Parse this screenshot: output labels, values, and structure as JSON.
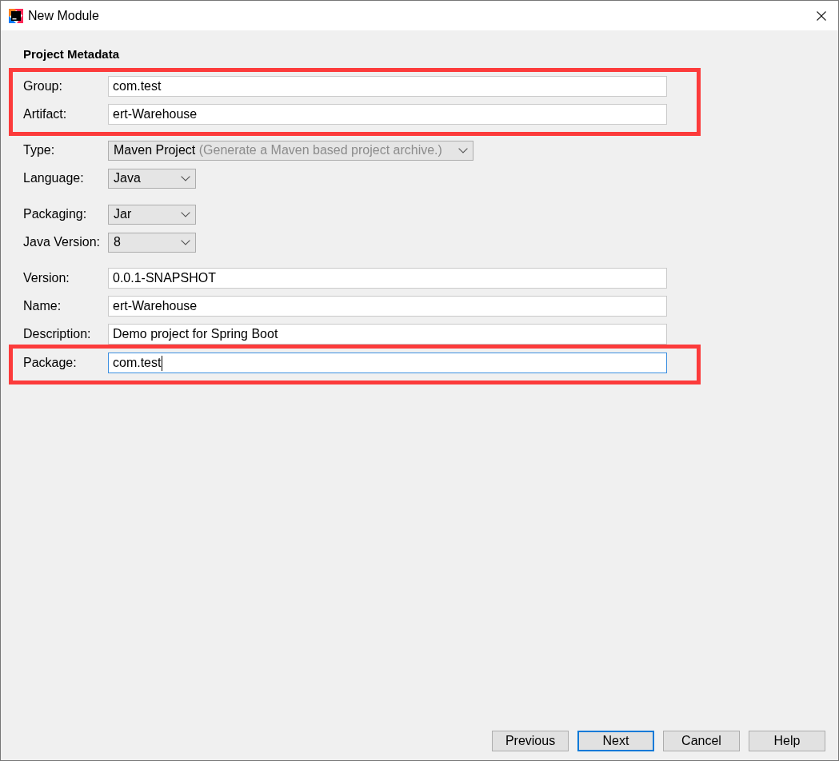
{
  "window": {
    "title": "New Module"
  },
  "section_title": "Project Metadata",
  "groups": [
    {
      "highlighted": true,
      "rows": [
        {
          "kind": "text",
          "label": "Group:",
          "value": "com.test",
          "focused": false
        },
        {
          "kind": "text",
          "label": "Artifact:",
          "value": "ert-Warehouse",
          "focused": false
        }
      ]
    },
    {
      "highlighted": false,
      "rows": [
        {
          "kind": "select",
          "label": "Type:",
          "value": "Maven Project",
          "hint": "(Generate a Maven based project archive.)"
        },
        {
          "kind": "select",
          "label": "Language:",
          "value": "Java"
        }
      ]
    },
    {
      "highlighted": false,
      "rows": [
        {
          "kind": "select",
          "label": "Packaging:",
          "value": "Jar"
        },
        {
          "kind": "select",
          "label": "Java Version:",
          "value": "8"
        }
      ]
    },
    {
      "highlighted": false,
      "rows": [
        {
          "kind": "text",
          "label": "Version:",
          "value": "0.0.1-SNAPSHOT",
          "focused": false
        },
        {
          "kind": "text",
          "label": "Name:",
          "value": "ert-Warehouse",
          "focused": false
        },
        {
          "kind": "text",
          "label": "Description:",
          "value": "Demo project for Spring Boot",
          "focused": false
        }
      ]
    },
    {
      "highlighted": true,
      "rows": [
        {
          "kind": "text",
          "label": "Package:",
          "value": "com.test",
          "focused": true
        }
      ]
    }
  ],
  "buttons": [
    {
      "label": "Previous",
      "default": false
    },
    {
      "label": "Next",
      "default": true
    },
    {
      "label": "Cancel",
      "default": false
    },
    {
      "label": "Help",
      "default": false
    }
  ]
}
